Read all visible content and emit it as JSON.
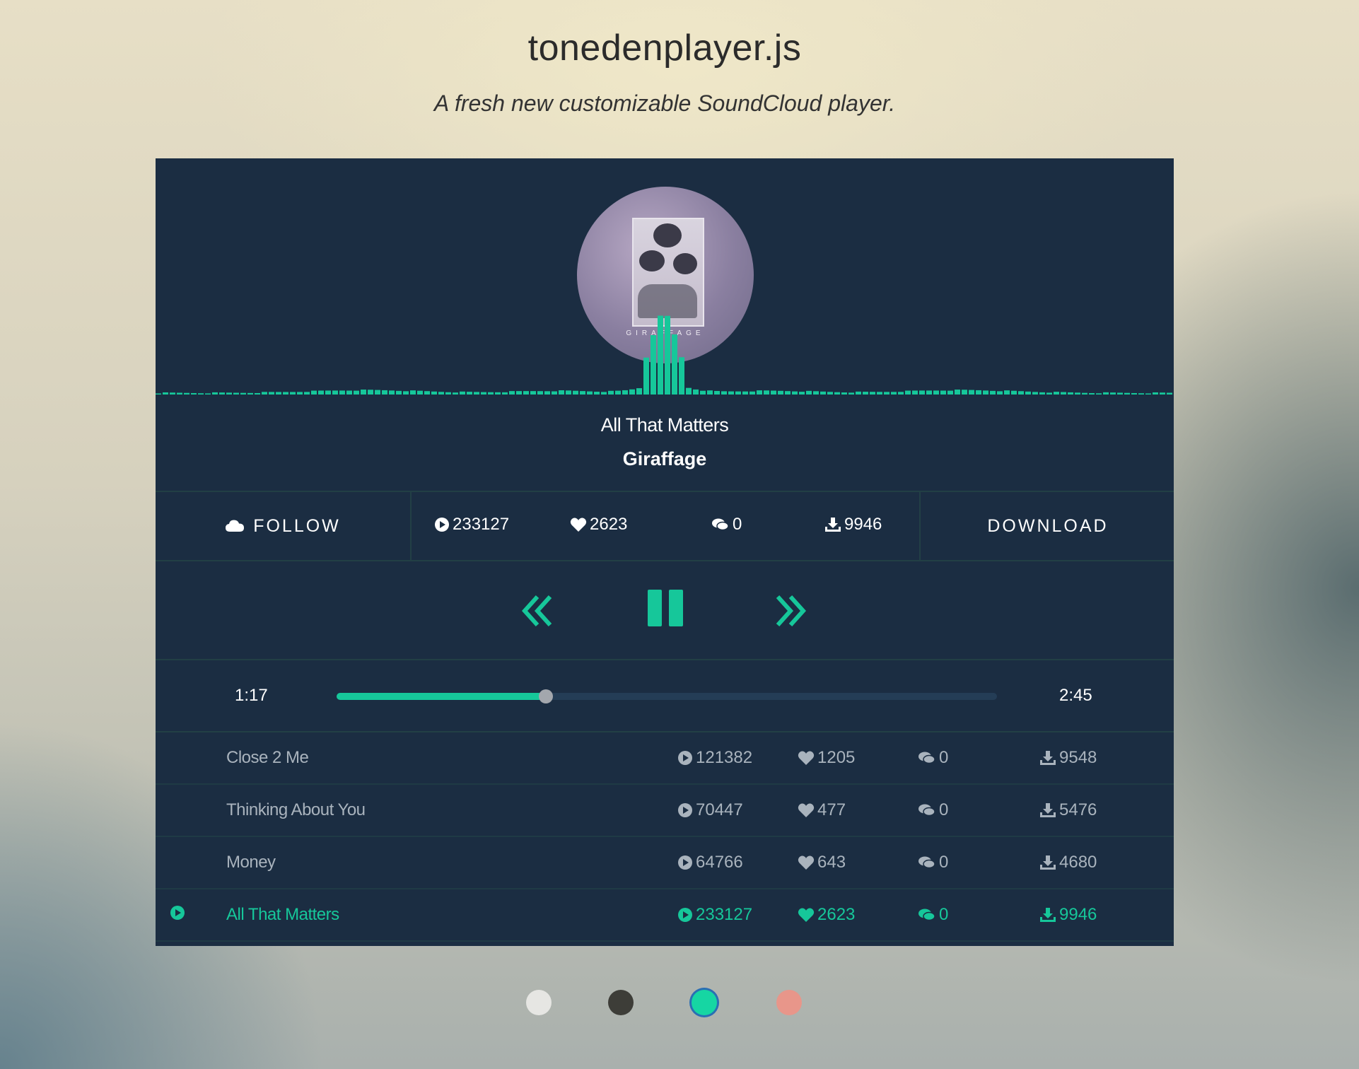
{
  "header": {
    "title": "tonedenplayer.js",
    "subtitle": "A fresh new customizable SoundCloud player."
  },
  "player": {
    "accent": "#16c79a",
    "background": "#1b2d42",
    "artwork_text": "GIRAFFAGE",
    "now_playing": {
      "title": "All That Matters",
      "artist": "Giraffage"
    },
    "actions": {
      "follow_label": "FOLLOW",
      "download_label": "DOWNLOAD"
    },
    "stats": {
      "plays": "233127",
      "likes": "2623",
      "comments": "0",
      "downloads": "9946"
    },
    "controls": {
      "prev_icon": "double-chevron-left-icon",
      "pause_icon": "pause-icon",
      "next_icon": "double-chevron-right-icon"
    },
    "progress": {
      "current": "1:17",
      "total": "2:45",
      "fraction": 0.317
    },
    "tracks": [
      {
        "name": "Close 2 Me",
        "plays": "121382",
        "likes": "1205",
        "comments": "0",
        "downloads": "9548",
        "active": false
      },
      {
        "name": "Thinking About You",
        "plays": "70447",
        "likes": "477",
        "comments": "0",
        "downloads": "5476",
        "active": false
      },
      {
        "name": "Money",
        "plays": "64766",
        "likes": "643",
        "comments": "0",
        "downloads": "4680",
        "active": false
      },
      {
        "name": "All That Matters",
        "plays": "233127",
        "likes": "2623",
        "comments": "0",
        "downloads": "9946",
        "active": true
      }
    ]
  },
  "theme_swatches": [
    {
      "color": "#e6e6e3",
      "selected": false
    },
    {
      "color": "#3d3d38",
      "selected": false
    },
    {
      "color": "#16d6a3",
      "selected": true
    },
    {
      "color": "#e8968a",
      "selected": false
    }
  ]
}
